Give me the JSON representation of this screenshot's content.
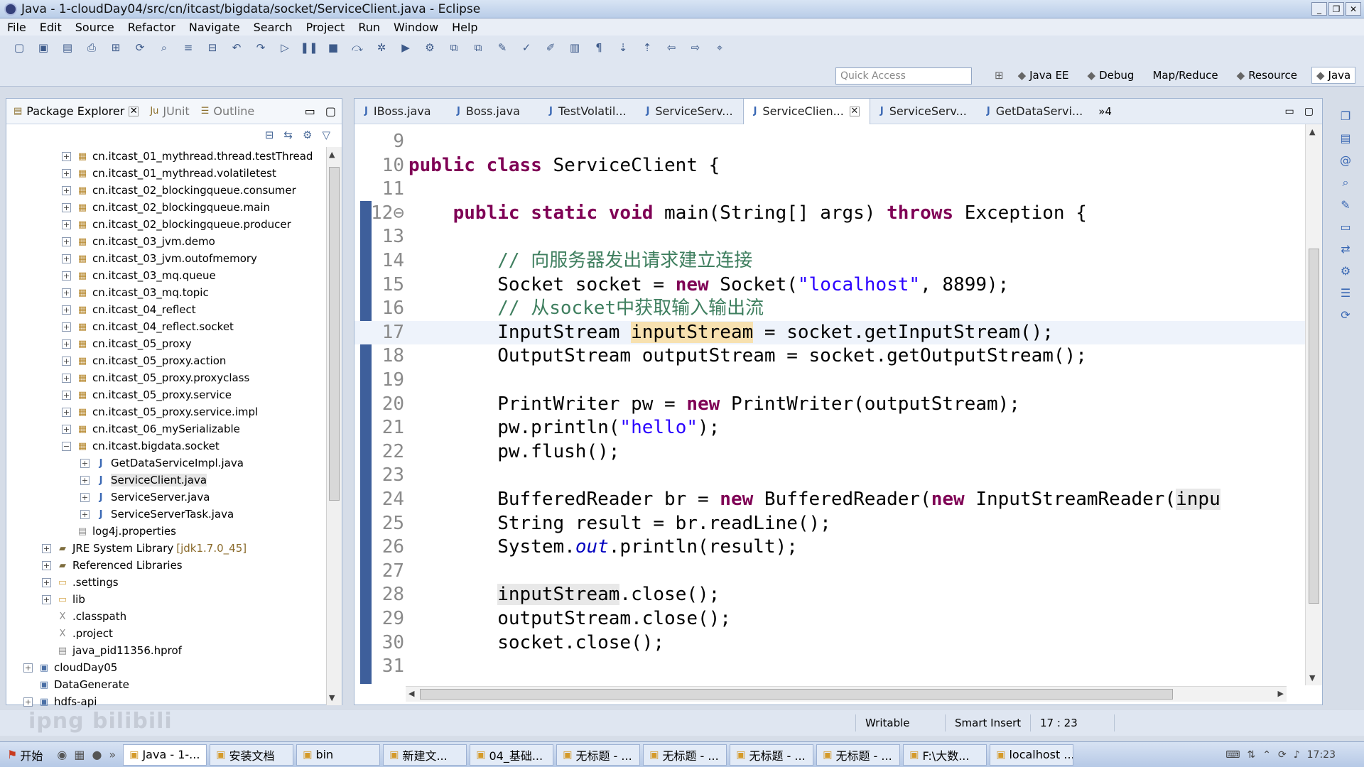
{
  "window": {
    "title": "Java - 1-cloudDay04/src/cn/itcast/bigdata/socket/ServiceClient.java - Eclipse"
  },
  "menu": [
    "File",
    "Edit",
    "Source",
    "Refactor",
    "Navigate",
    "Search",
    "Project",
    "Run",
    "Window",
    "Help"
  ],
  "toolbar": {
    "quick_access_placeholder": "Quick Access",
    "perspectives": [
      {
        "label": "Java EE",
        "icon": "java-ee-icon",
        "active": false
      },
      {
        "label": "Debug",
        "icon": "debug-icon",
        "active": false
      },
      {
        "label": "Map/Reduce",
        "icon": "",
        "active": false
      },
      {
        "label": "Resource",
        "icon": "resource-icon",
        "active": false
      },
      {
        "label": "Java",
        "icon": "java-icon",
        "active": true
      }
    ]
  },
  "package_explorer": {
    "tabs": [
      {
        "label": "Package Explorer",
        "active": true
      },
      {
        "label": "JUnit",
        "active": false
      },
      {
        "label": "Outline",
        "active": false
      }
    ],
    "tree": [
      {
        "label": "cn.itcast_01_mythread.thread.testThread",
        "indent": 2,
        "expander": "+",
        "icon": "package-icon"
      },
      {
        "label": "cn.itcast_01_mythread.volatiletest",
        "indent": 2,
        "expander": "+",
        "icon": "package-icon"
      },
      {
        "label": "cn.itcast_02_blockingqueue.consumer",
        "indent": 2,
        "expander": "+",
        "icon": "package-icon"
      },
      {
        "label": "cn.itcast_02_blockingqueue.main",
        "indent": 2,
        "expander": "+",
        "icon": "package-icon"
      },
      {
        "label": "cn.itcast_02_blockingqueue.producer",
        "indent": 2,
        "expander": "+",
        "icon": "package-icon"
      },
      {
        "label": "cn.itcast_03_jvm.demo",
        "indent": 2,
        "expander": "+",
        "icon": "package-icon"
      },
      {
        "label": "cn.itcast_03_jvm.outofmemory",
        "indent": 2,
        "expander": "+",
        "icon": "package-icon"
      },
      {
        "label": "cn.itcast_03_mq.queue",
        "indent": 2,
        "expander": "+",
        "icon": "package-icon"
      },
      {
        "label": "cn.itcast_03_mq.topic",
        "indent": 2,
        "expander": "+",
        "icon": "package-icon"
      },
      {
        "label": "cn.itcast_04_reflect",
        "indent": 2,
        "expander": "+",
        "icon": "package-icon"
      },
      {
        "label": "cn.itcast_04_reflect.socket",
        "indent": 2,
        "expander": "+",
        "icon": "package-icon"
      },
      {
        "label": "cn.itcast_05_proxy",
        "indent": 2,
        "expander": "+",
        "icon": "package-icon"
      },
      {
        "label": "cn.itcast_05_proxy.action",
        "indent": 2,
        "expander": "+",
        "icon": "package-icon"
      },
      {
        "label": "cn.itcast_05_proxy.proxyclass",
        "indent": 2,
        "expander": "+",
        "icon": "package-icon"
      },
      {
        "label": "cn.itcast_05_proxy.service",
        "indent": 2,
        "expander": "+",
        "icon": "package-icon"
      },
      {
        "label": "cn.itcast_05_proxy.service.impl",
        "indent": 2,
        "expander": "+",
        "icon": "package-icon"
      },
      {
        "label": "cn.itcast_06_mySerializable",
        "indent": 2,
        "expander": "+",
        "icon": "package-icon"
      },
      {
        "label": "cn.itcast.bigdata.socket",
        "indent": 2,
        "expander": "−",
        "icon": "package-icon"
      },
      {
        "label": "GetDataServiceImpl.java",
        "indent": 3,
        "expander": "+",
        "icon": "java-file-icon"
      },
      {
        "label": "ServiceClient.java",
        "indent": 3,
        "expander": "+",
        "icon": "java-file-icon",
        "selected": true
      },
      {
        "label": "ServiceServer.java",
        "indent": 3,
        "expander": "+",
        "icon": "java-file-icon"
      },
      {
        "label": "ServiceServerTask.java",
        "indent": 3,
        "expander": "+",
        "icon": "java-file-icon"
      },
      {
        "label": "log4j.properties",
        "indent": 2,
        "expander": "",
        "icon": "properties-file-icon"
      },
      {
        "label": "JRE System Library",
        "extra": "[jdk1.7.0_45]",
        "indent": 1,
        "expander": "+",
        "icon": "library-icon"
      },
      {
        "label": "Referenced Libraries",
        "indent": 1,
        "expander": "+",
        "icon": "library-icon"
      },
      {
        "label": ".settings",
        "indent": 1,
        "expander": "+",
        "icon": "folder-icon"
      },
      {
        "label": "lib",
        "indent": 1,
        "expander": "+",
        "icon": "folder-icon"
      },
      {
        "label": ".classpath",
        "indent": 1,
        "expander": "",
        "icon": "xml-file-icon"
      },
      {
        "label": ".project",
        "indent": 1,
        "expander": "",
        "icon": "xml-file-icon"
      },
      {
        "label": "java_pid11356.hprof",
        "indent": 1,
        "expander": "",
        "icon": "file-icon"
      },
      {
        "label": "cloudDay05",
        "indent": 0,
        "expander": "+",
        "icon": "project-icon"
      },
      {
        "label": "DataGenerate",
        "indent": 0,
        "expander": "",
        "icon": "project-icon"
      },
      {
        "label": "hdfs-api",
        "indent": 0,
        "expander": "+",
        "icon": "project-icon"
      }
    ]
  },
  "editor": {
    "tabs": [
      {
        "label": "IBoss.java",
        "active": false
      },
      {
        "label": "Boss.java",
        "active": false
      },
      {
        "label": "TestVolatil...",
        "active": false
      },
      {
        "label": "ServiceServ...",
        "active": false
      },
      {
        "label": "ServiceClien...",
        "active": true
      },
      {
        "label": "ServiceServ...",
        "active": false
      },
      {
        "label": "GetDataServi...",
        "active": false
      }
    ],
    "overflow_label": "»4",
    "lines": [
      {
        "n": "9",
        "tokens": []
      },
      {
        "n": "10",
        "tokens": [
          {
            "t": "public class",
            "c": "kw"
          },
          {
            "t": " ServiceClient {",
            "c": ""
          }
        ]
      },
      {
        "n": "11",
        "tokens": []
      },
      {
        "n": "12⊖",
        "tokens": [
          {
            "t": "    ",
            "c": ""
          },
          {
            "t": "public static void",
            "c": "kw"
          },
          {
            "t": " main(String[] args) ",
            "c": ""
          },
          {
            "t": "throws",
            "c": "kw"
          },
          {
            "t": " Exception {",
            "c": ""
          }
        ]
      },
      {
        "n": "13",
        "tokens": []
      },
      {
        "n": "14",
        "tokens": [
          {
            "t": "        ",
            "c": ""
          },
          {
            "t": "// 向服务器发出请求建立连接",
            "c": "cm"
          }
        ]
      },
      {
        "n": "15",
        "tokens": [
          {
            "t": "        Socket socket = ",
            "c": ""
          },
          {
            "t": "new",
            "c": "kw"
          },
          {
            "t": " Socket(",
            "c": ""
          },
          {
            "t": "\"localhost\"",
            "c": "str"
          },
          {
            "t": ", 8899);",
            "c": ""
          }
        ]
      },
      {
        "n": "16",
        "tokens": [
          {
            "t": "        ",
            "c": ""
          },
          {
            "t": "// 从socket中获取输入输出流",
            "c": "cm"
          }
        ]
      },
      {
        "n": "17",
        "current": true,
        "tokens": [
          {
            "t": "        InputStream ",
            "c": ""
          },
          {
            "t": "inputStream",
            "c": "hl"
          },
          {
            "t": " = socket.getInputStream();",
            "c": ""
          }
        ]
      },
      {
        "n": "18",
        "tokens": [
          {
            "t": "        OutputStream outputStream = socket.getOutputStream();",
            "c": ""
          }
        ]
      },
      {
        "n": "19",
        "tokens": []
      },
      {
        "n": "20",
        "tokens": [
          {
            "t": "        PrintWriter pw = ",
            "c": ""
          },
          {
            "t": "new",
            "c": "kw"
          },
          {
            "t": " PrintWriter(outputStream);",
            "c": ""
          }
        ]
      },
      {
        "n": "21",
        "tokens": [
          {
            "t": "        pw.println(",
            "c": ""
          },
          {
            "t": "\"hello\"",
            "c": "str"
          },
          {
            "t": ");",
            "c": ""
          }
        ]
      },
      {
        "n": "22",
        "tokens": [
          {
            "t": "        pw.flush();",
            "c": ""
          }
        ]
      },
      {
        "n": "23",
        "tokens": []
      },
      {
        "n": "24",
        "tokens": [
          {
            "t": "        BufferedReader br = ",
            "c": ""
          },
          {
            "t": "new",
            "c": "kw"
          },
          {
            "t": " BufferedReader(",
            "c": ""
          },
          {
            "t": "new",
            "c": "kw"
          },
          {
            "t": " InputStreamReader(",
            "c": ""
          },
          {
            "t": "inpu",
            "c": "hl2"
          }
        ]
      },
      {
        "n": "25",
        "tokens": [
          {
            "t": "        String result = br.readLine();",
            "c": ""
          }
        ]
      },
      {
        "n": "26",
        "tokens": [
          {
            "t": "        System.",
            "c": ""
          },
          {
            "t": "out",
            "c": "fld"
          },
          {
            "t": ".println(result);",
            "c": ""
          }
        ]
      },
      {
        "n": "27",
        "tokens": []
      },
      {
        "n": "28",
        "tokens": [
          {
            "t": "        ",
            "c": ""
          },
          {
            "t": "inputStream",
            "c": "hl2"
          },
          {
            "t": ".close();",
            "c": ""
          }
        ]
      },
      {
        "n": "29",
        "tokens": [
          {
            "t": "        outputStream.close();",
            "c": ""
          }
        ]
      },
      {
        "n": "30",
        "tokens": [
          {
            "t": "        socket.close();",
            "c": ""
          }
        ]
      },
      {
        "n": "31",
        "tokens": []
      }
    ]
  },
  "status": {
    "mode": "Writable",
    "insert": "Smart Insert",
    "position": "17 : 23"
  },
  "watermark": "ipng bilibili",
  "taskbar": {
    "start_label": "开始",
    "tasks": [
      {
        "label": "Java - 1-...",
        "active": true
      },
      {
        "label": "安装文档",
        "active": false
      },
      {
        "label": "bin",
        "active": false
      },
      {
        "label": "新建文...",
        "active": false
      },
      {
        "label": "04_基础...",
        "active": false
      },
      {
        "label": "无标题 - ...",
        "active": false
      },
      {
        "label": "无标题 - ...",
        "active": false
      },
      {
        "label": "无标题 - ...",
        "active": false
      },
      {
        "label": "无标题 - ...",
        "active": false
      },
      {
        "label": "F:\\大数...",
        "active": false
      },
      {
        "label": "localhost ...",
        "active": false
      }
    ],
    "clock": "17:23"
  }
}
